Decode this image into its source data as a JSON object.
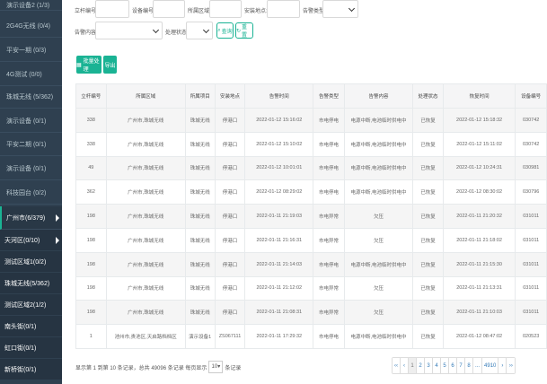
{
  "sidebar": {
    "items": [
      {
        "label": "演示设备2 (1/3)"
      },
      {
        "label": "2G4G无线 (0/4)"
      },
      {
        "label": "平安一期 (0/3)"
      },
      {
        "label": "4G测试 (0/0)"
      },
      {
        "label": "珠城无线 (5/362)"
      },
      {
        "label": "演示设备 (0/1)"
      },
      {
        "label": "平安二期 (0/1)"
      },
      {
        "label": "演示设备 (0/1)"
      },
      {
        "label": "科技园台 (0/2)"
      },
      {
        "label": "广州市(6/379)"
      }
    ],
    "sub_items": [
      {
        "label": "天河区(0/10)"
      },
      {
        "label": "测试区域1(0/2)"
      },
      {
        "label": "珠城无线(5/362)"
      },
      {
        "label": "测试区域2(1/2)"
      },
      {
        "label": "南头街(0/1)"
      },
      {
        "label": "虹口街(0/1)"
      },
      {
        "label": "新桥街(0/1)"
      }
    ]
  },
  "filters": {
    "terminal_no_label": "立杆编号:",
    "device_no_label": "设备编号:",
    "area_label": "所属区域:",
    "install_label": "安装地点:",
    "alarm_type_label": "告警类型:",
    "alarm_content_label": "告警内容:",
    "status_label": "处理状态:",
    "query_label": "查询",
    "reset_label": "重置"
  },
  "actions": {
    "batch_label": "批量处理",
    "export_label": "导出"
  },
  "table": {
    "headers": [
      "立杆编号",
      "所属区域",
      "所属项目",
      "安装地点",
      "告警时间",
      "告警类型",
      "告警内容",
      "处理状态",
      "恢复时间",
      "设备编号"
    ],
    "rows": [
      [
        "338",
        "广州市,珠城无线",
        "珠城无线",
        "停港口",
        "2022-01-12 15:16:02",
        "市电停电",
        "电源中断,电池临时供电中",
        "已恢复",
        "2022-01-12 15:18:32",
        "030742"
      ],
      [
        "338",
        "广州市,珠城无线",
        "珠城无线",
        "停港口",
        "2022-01-12 15:10:02",
        "市电停电",
        "电源中断,电池临时供电中",
        "已恢复",
        "2022-01-12 15:11:02",
        "030742"
      ],
      [
        "49",
        "广州市,珠城无线",
        "珠城无线",
        "停港口",
        "2022-01-12 10:01:01",
        "市电停电",
        "电源中断,电池临时供电中",
        "已恢复",
        "2022-01-12 10:24:31",
        "030981"
      ],
      [
        "362",
        "广州市,珠城无线",
        "珠城无线",
        "停港口",
        "2022-01-12 08:29:02",
        "市电停电",
        "电源中断,电池临时供电中",
        "已恢复",
        "2022-01-12 08:30:02",
        "030796"
      ],
      [
        "198",
        "广州市,珠城无线",
        "珠城无线",
        "停港口",
        "2022-01-11 21:19:03",
        "市电异常",
        "欠压",
        "已恢复",
        "2022-01-11 21:20:32",
        "031011"
      ],
      [
        "198",
        "广州市,珠城无线",
        "珠城无线",
        "停港口",
        "2022-01-11 21:16:31",
        "市电异常",
        "欠压",
        "已恢复",
        "2022-01-11 21:18:02",
        "031011"
      ],
      [
        "198",
        "广州市,珠城无线",
        "珠城无线",
        "停港口",
        "2022-01-11 21:14:03",
        "市电停电",
        "电源中断,电池临时供电中",
        "已恢复",
        "2022-01-11 21:15:30",
        "031011"
      ],
      [
        "198",
        "广州市,珠城无线",
        "珠城无线",
        "停港口",
        "2022-01-11 21:12:02",
        "市电异常",
        "欠压",
        "已恢复",
        "2022-01-11 21:13:31",
        "031011"
      ],
      [
        "198",
        "广州市,珠城无线",
        "珠城无线",
        "停港口",
        "2022-01-11 21:08:31",
        "市电异常",
        "欠压",
        "已恢复",
        "2022-01-11 21:10:03",
        "031011"
      ],
      [
        "1",
        "池州市,贵池区,天启路档档区",
        "演示设备1",
        "ZS067111",
        "2022-01-11 17:29:32",
        "市电停电",
        "电源中断,电池临时供电中",
        "已恢复",
        "2022-01-12 08:47:02",
        "020523"
      ]
    ]
  },
  "footer": {
    "info_prefix": "显示第 1 到第 10 条记录，总共 49096 条记录 每页显示",
    "page_size": "10",
    "info_suffix": "条记录",
    "pages": [
      "‹‹",
      "‹",
      "1",
      "2",
      "3",
      "4",
      "5",
      "6",
      "7",
      "8",
      "...",
      "4910",
      "›",
      "››"
    ]
  }
}
